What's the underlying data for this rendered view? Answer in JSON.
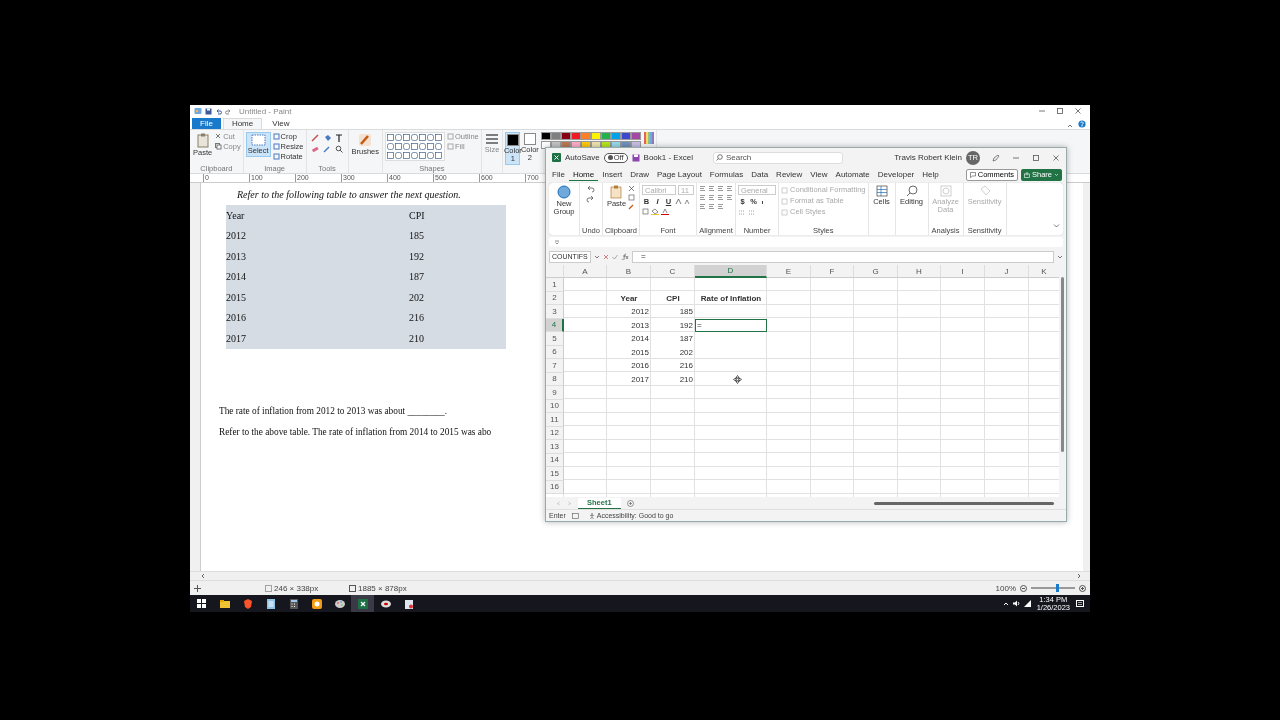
{
  "paint": {
    "title": "Untitled - Paint",
    "tabs": [
      {
        "label": "File",
        "selected": false,
        "kind": "file"
      },
      {
        "label": "Home",
        "selected": true,
        "kind": "tab"
      },
      {
        "label": "View",
        "selected": false,
        "kind": "tab"
      }
    ],
    "ribbon": [
      {
        "kind": "clipboard",
        "label": "Clipboard",
        "buttons": [
          "Paste",
          "Cut",
          "Copy"
        ]
      },
      {
        "kind": "image",
        "label": "Image",
        "buttons": [
          "Select",
          "Crop",
          "Resize",
          "Rotate"
        ]
      },
      {
        "kind": "tools",
        "label": "Tools"
      },
      {
        "kind": "brushes",
        "buttons": [
          "Brushes"
        ]
      },
      {
        "kind": "shapes",
        "label": "Shapes",
        "buttons": [
          "Outline",
          "Fill"
        ]
      },
      {
        "kind": "size",
        "buttons": [
          "Size"
        ]
      },
      {
        "kind": "colors",
        "buttons": [
          "Color 1",
          "Color 2"
        ]
      }
    ],
    "palette": [
      {
        "color": "#000000"
      },
      {
        "color": "#7f7f7f"
      },
      {
        "color": "#880015"
      },
      {
        "color": "#ed1c24"
      },
      {
        "color": "#ff7f27"
      },
      {
        "color": "#fff200"
      },
      {
        "color": "#22b14c"
      },
      {
        "color": "#00a2e8"
      },
      {
        "color": "#3f48cc"
      },
      {
        "color": "#a349a4"
      },
      {
        "color": "#ffffff"
      },
      {
        "color": "#c3c3c3"
      },
      {
        "color": "#b97a57"
      },
      {
        "color": "#ffaec9"
      },
      {
        "color": "#ffc90e"
      },
      {
        "color": "#efe4b0"
      },
      {
        "color": "#b5e61d"
      },
      {
        "color": "#99d9ea"
      },
      {
        "color": "#7092be"
      },
      {
        "color": "#c8bfe7"
      }
    ],
    "ruler": [
      "0",
      "100",
      "200",
      "300",
      "400",
      "500",
      "600",
      "700"
    ],
    "canvas": {
      "heading": "Refer to the following table to answer the next question.",
      "table": {
        "columns": [
          "Year",
          "CPI"
        ],
        "rows": [
          [
            "2012",
            "185"
          ],
          [
            "2013",
            "192"
          ],
          [
            "2014",
            "187"
          ],
          [
            "2015",
            "202"
          ],
          [
            "2016",
            "216"
          ],
          [
            "2017",
            "210"
          ]
        ]
      },
      "questions": [
        "The rate of inflation from 2012 to 2013 was about ________.",
        "Refer to the above table. The rate of inflation from 2014 to 2015 was abo"
      ]
    },
    "status": {
      "selection": "246 × 338px",
      "size": "1885 × 878px",
      "zoom": "100%",
      "zoom_level": {
        "level": 0.6
      }
    }
  },
  "excel": {
    "autosave": "AutoSave",
    "autosave_state": "Off",
    "title": "Book1 - Excel",
    "search": {
      "placeholder": "Search"
    },
    "user": "Travis Robert Klein",
    "avatar": "TR",
    "tabs": [
      {
        "label": "File",
        "selected": false
      },
      {
        "label": "Home",
        "selected": true
      },
      {
        "label": "Insert",
        "selected": false
      },
      {
        "label": "Draw",
        "selected": false
      },
      {
        "label": "Page Layout",
        "selected": false
      },
      {
        "label": "Formulas",
        "selected": false
      },
      {
        "label": "Data",
        "selected": false
      },
      {
        "label": "Review",
        "selected": false
      },
      {
        "label": "View",
        "selected": false
      },
      {
        "label": "Automate",
        "selected": false
      },
      {
        "label": "Developer",
        "selected": false
      },
      {
        "label": "Help",
        "selected": false
      }
    ],
    "comments": "Comments",
    "share": "Share",
    "ribbon": [
      {
        "kind": "new_group",
        "button": "New Group"
      },
      {
        "kind": "undo",
        "label": "Undo"
      },
      {
        "kind": "clipboard",
        "label": "Clipboard",
        "button": "Paste"
      },
      {
        "kind": "font",
        "label": "Font",
        "font": "Calibri",
        "size": "11",
        "disabled": true,
        "styles": [
          "B",
          "I",
          "U"
        ]
      },
      {
        "kind": "alignment",
        "label": "Alignment"
      },
      {
        "kind": "number",
        "label": "Number",
        "format": "General",
        "disabled": true,
        "symbols": [
          "$",
          "%"
        ]
      },
      {
        "kind": "styles",
        "label": "Styles",
        "items": [
          {
            "label": "Conditional Formatting",
            "disabled": true
          },
          {
            "label": "Format as Table",
            "disabled": true
          },
          {
            "label": "Cell Styles",
            "disabled": true
          }
        ]
      },
      {
        "kind": "cells",
        "button": "Cells"
      },
      {
        "kind": "editing",
        "button": "Editing"
      },
      {
        "kind": "analysis",
        "label": "Analysis",
        "button": "Analyze Data",
        "disabled": true
      },
      {
        "kind": "sensitivity",
        "label": "Sensitivity",
        "button": "Sensitivity",
        "disabled": true
      }
    ],
    "name_box": "COUNTIFS",
    "formula": "=",
    "columns": [
      {
        "label": "A",
        "selected": false
      },
      {
        "label": "B",
        "selected": false
      },
      {
        "label": "C",
        "selected": false
      },
      {
        "label": "D",
        "selected": true
      },
      {
        "label": "E",
        "selected": false
      },
      {
        "label": "F",
        "selected": false
      },
      {
        "label": "G",
        "selected": false
      },
      {
        "label": "H",
        "selected": false
      },
      {
        "label": "I",
        "selected": false
      },
      {
        "label": "J",
        "selected": false
      },
      {
        "label": "K",
        "selected": false
      }
    ],
    "rows": [
      {
        "label": "1",
        "selected": false
      },
      {
        "label": "2",
        "selected": false,
        "kind": "header",
        "cells": [
          "",
          "Year",
          "CPI",
          "Rate of Inflation"
        ]
      },
      {
        "label": "3",
        "selected": false,
        "kind": "data",
        "cells": [
          "",
          "2012",
          "185"
        ]
      },
      {
        "label": "4",
        "selected": true,
        "kind": "data",
        "cells": [
          "",
          "2013",
          "192",
          "="
        ]
      },
      {
        "label": "5",
        "selected": false,
        "kind": "data",
        "cells": [
          "",
          "2014",
          "187"
        ]
      },
      {
        "label": "6",
        "selected": false,
        "kind": "data",
        "cells": [
          "",
          "2015",
          "202"
        ]
      },
      {
        "label": "7",
        "selected": false,
        "kind": "data",
        "cells": [
          "",
          "2016",
          "216"
        ]
      },
      {
        "label": "8",
        "selected": false,
        "kind": "data",
        "cells": [
          "",
          "2017",
          "210"
        ]
      },
      {
        "label": "9",
        "selected": false
      },
      {
        "label": "10",
        "selected": false
      },
      {
        "label": "11",
        "selected": false
      },
      {
        "label": "12",
        "selected": false
      },
      {
        "label": "13",
        "selected": false
      },
      {
        "label": "14",
        "selected": false
      },
      {
        "label": "15",
        "selected": false
      },
      {
        "label": "16",
        "selected": false
      }
    ],
    "sheets": [
      {
        "label": "Sheet1",
        "selected": true
      }
    ],
    "status": {
      "mode": "Enter",
      "accessibility": "Accessibility: Good to go"
    }
  },
  "taskbar": {
    "apps": [
      {
        "kind": "folder",
        "selected": false
      },
      {
        "kind": "browser",
        "selected": false
      },
      {
        "kind": "notes",
        "selected": false
      },
      {
        "kind": "calculator",
        "selected": false
      },
      {
        "kind": "orange",
        "selected": false
      },
      {
        "kind": "paint",
        "selected": false
      },
      {
        "kind": "excel",
        "selected": true
      },
      {
        "kind": "recorder",
        "selected": false
      },
      {
        "kind": "tool",
        "selected": false
      }
    ],
    "time": "1:34 PM",
    "date": "1/26/2023"
  }
}
